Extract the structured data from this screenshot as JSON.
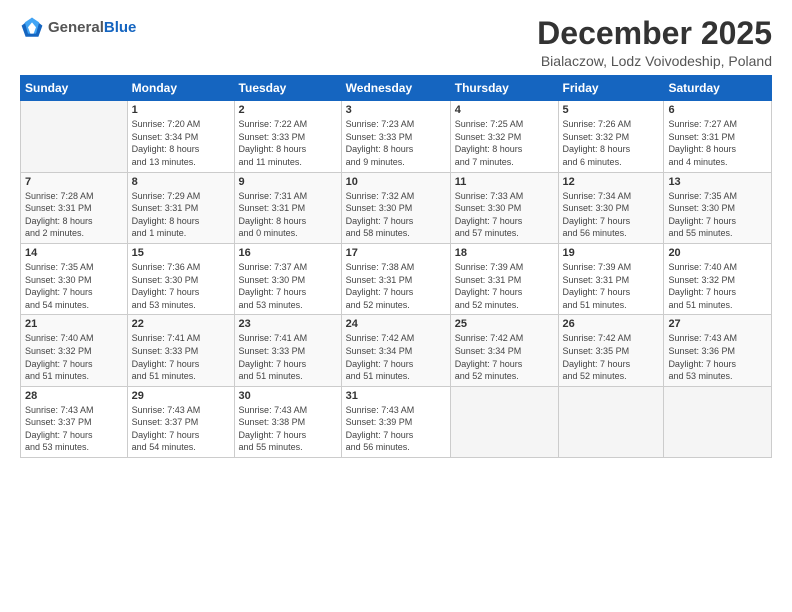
{
  "logo": {
    "general": "General",
    "blue": "Blue"
  },
  "header": {
    "title": "December 2025",
    "subtitle": "Bialaczow, Lodz Voivodeship, Poland"
  },
  "calendar": {
    "days_of_week": [
      "Sunday",
      "Monday",
      "Tuesday",
      "Wednesday",
      "Thursday",
      "Friday",
      "Saturday"
    ],
    "weeks": [
      [
        {
          "day": "",
          "info": ""
        },
        {
          "day": "1",
          "info": "Sunrise: 7:20 AM\nSunset: 3:34 PM\nDaylight: 8 hours\nand 13 minutes."
        },
        {
          "day": "2",
          "info": "Sunrise: 7:22 AM\nSunset: 3:33 PM\nDaylight: 8 hours\nand 11 minutes."
        },
        {
          "day": "3",
          "info": "Sunrise: 7:23 AM\nSunset: 3:33 PM\nDaylight: 8 hours\nand 9 minutes."
        },
        {
          "day": "4",
          "info": "Sunrise: 7:25 AM\nSunset: 3:32 PM\nDaylight: 8 hours\nand 7 minutes."
        },
        {
          "day": "5",
          "info": "Sunrise: 7:26 AM\nSunset: 3:32 PM\nDaylight: 8 hours\nand 6 minutes."
        },
        {
          "day": "6",
          "info": "Sunrise: 7:27 AM\nSunset: 3:31 PM\nDaylight: 8 hours\nand 4 minutes."
        }
      ],
      [
        {
          "day": "7",
          "info": "Sunrise: 7:28 AM\nSunset: 3:31 PM\nDaylight: 8 hours\nand 2 minutes."
        },
        {
          "day": "8",
          "info": "Sunrise: 7:29 AM\nSunset: 3:31 PM\nDaylight: 8 hours\nand 1 minute."
        },
        {
          "day": "9",
          "info": "Sunrise: 7:31 AM\nSunset: 3:31 PM\nDaylight: 8 hours\nand 0 minutes."
        },
        {
          "day": "10",
          "info": "Sunrise: 7:32 AM\nSunset: 3:30 PM\nDaylight: 7 hours\nand 58 minutes."
        },
        {
          "day": "11",
          "info": "Sunrise: 7:33 AM\nSunset: 3:30 PM\nDaylight: 7 hours\nand 57 minutes."
        },
        {
          "day": "12",
          "info": "Sunrise: 7:34 AM\nSunset: 3:30 PM\nDaylight: 7 hours\nand 56 minutes."
        },
        {
          "day": "13",
          "info": "Sunrise: 7:35 AM\nSunset: 3:30 PM\nDaylight: 7 hours\nand 55 minutes."
        }
      ],
      [
        {
          "day": "14",
          "info": "Sunrise: 7:35 AM\nSunset: 3:30 PM\nDaylight: 7 hours\nand 54 minutes."
        },
        {
          "day": "15",
          "info": "Sunrise: 7:36 AM\nSunset: 3:30 PM\nDaylight: 7 hours\nand 53 minutes."
        },
        {
          "day": "16",
          "info": "Sunrise: 7:37 AM\nSunset: 3:30 PM\nDaylight: 7 hours\nand 53 minutes."
        },
        {
          "day": "17",
          "info": "Sunrise: 7:38 AM\nSunset: 3:31 PM\nDaylight: 7 hours\nand 52 minutes."
        },
        {
          "day": "18",
          "info": "Sunrise: 7:39 AM\nSunset: 3:31 PM\nDaylight: 7 hours\nand 52 minutes."
        },
        {
          "day": "19",
          "info": "Sunrise: 7:39 AM\nSunset: 3:31 PM\nDaylight: 7 hours\nand 51 minutes."
        },
        {
          "day": "20",
          "info": "Sunrise: 7:40 AM\nSunset: 3:32 PM\nDaylight: 7 hours\nand 51 minutes."
        }
      ],
      [
        {
          "day": "21",
          "info": "Sunrise: 7:40 AM\nSunset: 3:32 PM\nDaylight: 7 hours\nand 51 minutes."
        },
        {
          "day": "22",
          "info": "Sunrise: 7:41 AM\nSunset: 3:33 PM\nDaylight: 7 hours\nand 51 minutes."
        },
        {
          "day": "23",
          "info": "Sunrise: 7:41 AM\nSunset: 3:33 PM\nDaylight: 7 hours\nand 51 minutes."
        },
        {
          "day": "24",
          "info": "Sunrise: 7:42 AM\nSunset: 3:34 PM\nDaylight: 7 hours\nand 51 minutes."
        },
        {
          "day": "25",
          "info": "Sunrise: 7:42 AM\nSunset: 3:34 PM\nDaylight: 7 hours\nand 52 minutes."
        },
        {
          "day": "26",
          "info": "Sunrise: 7:42 AM\nSunset: 3:35 PM\nDaylight: 7 hours\nand 52 minutes."
        },
        {
          "day": "27",
          "info": "Sunrise: 7:43 AM\nSunset: 3:36 PM\nDaylight: 7 hours\nand 53 minutes."
        }
      ],
      [
        {
          "day": "28",
          "info": "Sunrise: 7:43 AM\nSunset: 3:37 PM\nDaylight: 7 hours\nand 53 minutes."
        },
        {
          "day": "29",
          "info": "Sunrise: 7:43 AM\nSunset: 3:37 PM\nDaylight: 7 hours\nand 54 minutes."
        },
        {
          "day": "30",
          "info": "Sunrise: 7:43 AM\nSunset: 3:38 PM\nDaylight: 7 hours\nand 55 minutes."
        },
        {
          "day": "31",
          "info": "Sunrise: 7:43 AM\nSunset: 3:39 PM\nDaylight: 7 hours\nand 56 minutes."
        },
        {
          "day": "",
          "info": ""
        },
        {
          "day": "",
          "info": ""
        },
        {
          "day": "",
          "info": ""
        }
      ]
    ]
  }
}
